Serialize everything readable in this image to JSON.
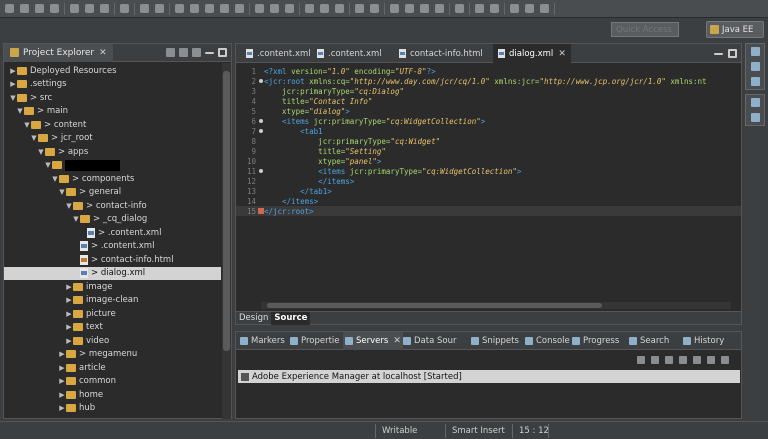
{
  "toolbar": {
    "quick_access_placeholder": "Quick Access",
    "perspective": "Java EE"
  },
  "explorer": {
    "title": "Project Explorer",
    "close": "✕",
    "rows": [
      {
        "label": "Deployed Resources",
        "depth": 0,
        "tw": "▶",
        "icon": "folder"
      },
      {
        "label": ".settings",
        "depth": 0,
        "tw": "▶",
        "icon": "folder"
      },
      {
        "label": "> src",
        "depth": 0,
        "tw": "▼",
        "icon": "folder"
      },
      {
        "label": "> main",
        "depth": 1,
        "tw": "▼",
        "icon": "folder"
      },
      {
        "label": "> content",
        "depth": 2,
        "tw": "▼",
        "icon": "folder"
      },
      {
        "label": "> jcr_root",
        "depth": 3,
        "tw": "▼",
        "icon": "folder"
      },
      {
        "label": "> apps",
        "depth": 4,
        "tw": "▼",
        "icon": "folder"
      },
      {
        "label": "",
        "depth": 5,
        "tw": "▼",
        "icon": "folder",
        "redacted": true
      },
      {
        "label": "> components",
        "depth": 6,
        "tw": "▼",
        "icon": "folder"
      },
      {
        "label": "> general",
        "depth": 7,
        "tw": "▼",
        "icon": "folder"
      },
      {
        "label": "> contact-info",
        "depth": 8,
        "tw": "▼",
        "icon": "folder"
      },
      {
        "label": "> _cq_dialog",
        "depth": 9,
        "tw": "▼",
        "icon": "folder"
      },
      {
        "label": "> .content.xml",
        "depth": 10,
        "tw": "",
        "icon": "xml"
      },
      {
        "label": "> .content.xml",
        "depth": 9,
        "tw": "",
        "icon": "xml"
      },
      {
        "label": "> contact-info.html",
        "depth": 9,
        "tw": "",
        "icon": "html"
      },
      {
        "label": "> dialog.xml",
        "depth": 9,
        "tw": "",
        "icon": "xml",
        "selected": true
      },
      {
        "label": "image",
        "depth": 8,
        "tw": "▶",
        "icon": "folder"
      },
      {
        "label": "image-clean",
        "depth": 8,
        "tw": "▶",
        "icon": "folder"
      },
      {
        "label": "picture",
        "depth": 8,
        "tw": "▶",
        "icon": "folder"
      },
      {
        "label": "text",
        "depth": 8,
        "tw": "▶",
        "icon": "folder"
      },
      {
        "label": "video",
        "depth": 8,
        "tw": "▶",
        "icon": "folder"
      },
      {
        "label": "> megamenu",
        "depth": 7,
        "tw": "▶",
        "icon": "folder"
      },
      {
        "label": "article",
        "depth": 7,
        "tw": "▶",
        "icon": "folder"
      },
      {
        "label": "common",
        "depth": 7,
        "tw": "▶",
        "icon": "folder"
      },
      {
        "label": "home",
        "depth": 7,
        "tw": "▶",
        "icon": "folder"
      },
      {
        "label": "hub",
        "depth": 7,
        "tw": "▶",
        "icon": "folder"
      }
    ]
  },
  "editor": {
    "tabs": [
      {
        "label": ".content.xml",
        "active": false
      },
      {
        "label": ".content.xml",
        "active": false
      },
      {
        "label": "contact-info.html",
        "active": false
      },
      {
        "label": "dialog.xml",
        "active": true
      }
    ],
    "lines": [
      [
        {
          "t": "<?xml ",
          "c": "pi"
        },
        {
          "t": "version=",
          "c": "attr"
        },
        {
          "t": "\"1.0\"",
          "c": "val"
        },
        {
          "t": " encoding=",
          "c": "attr"
        },
        {
          "t": "\"UTF-8\"",
          "c": "val"
        },
        {
          "t": "?>",
          "c": "pi"
        }
      ],
      [
        {
          "t": "<jcr:root ",
          "c": "tag"
        },
        {
          "t": "xmlns:cq=",
          "c": "attr"
        },
        {
          "t": "\"http://www.day.com/jcr/cq/1.0\"",
          "c": "val"
        },
        {
          "t": " xmlns:jcr=",
          "c": "attr"
        },
        {
          "t": "\"http://www.jcp.org/jcr/1.0\"",
          "c": "val"
        },
        {
          "t": " xmlns:nt",
          "c": "attr"
        }
      ],
      [
        {
          "t": "    jcr:primaryType=",
          "c": "attr"
        },
        {
          "t": "\"cq:Dialog\"",
          "c": "val"
        }
      ],
      [
        {
          "t": "    title=",
          "c": "attr"
        },
        {
          "t": "\"Contact Info\"",
          "c": "val"
        }
      ],
      [
        {
          "t": "    xtype=",
          "c": "attr"
        },
        {
          "t": "\"dialog\"",
          "c": "val"
        },
        {
          "t": ">",
          "c": "tag"
        }
      ],
      [
        {
          "t": "    <items ",
          "c": "tag"
        },
        {
          "t": "jcr:primaryType=",
          "c": "attr"
        },
        {
          "t": "\"cq:WidgetCollection\"",
          "c": "val"
        },
        {
          "t": ">",
          "c": "tag"
        }
      ],
      [
        {
          "t": "        <tab1",
          "c": "tag"
        }
      ],
      [
        {
          "t": "            jcr:primaryType=",
          "c": "attr"
        },
        {
          "t": "\"cq:Widget\"",
          "c": "val"
        }
      ],
      [
        {
          "t": "            title=",
          "c": "attr"
        },
        {
          "t": "\"Setting\"",
          "c": "val"
        }
      ],
      [
        {
          "t": "            xtype=",
          "c": "attr"
        },
        {
          "t": "\"panel\"",
          "c": "val"
        },
        {
          "t": ">",
          "c": "tag"
        }
      ],
      [
        {
          "t": "            <items ",
          "c": "tag"
        },
        {
          "t": "jcr:primaryType=",
          "c": "attr"
        },
        {
          "t": "\"cq:WidgetCollection\"",
          "c": "val"
        },
        {
          "t": ">",
          "c": "tag"
        }
      ],
      [
        {
          "t": "            </items>",
          "c": "tag"
        }
      ],
      [
        {
          "t": "        </tab1>",
          "c": "tag"
        }
      ],
      [
        {
          "t": "    </items>",
          "c": "tag"
        }
      ],
      [
        {
          "t": "</jcr:root>",
          "c": "tag"
        }
      ]
    ],
    "fold_lines": [
      2,
      6,
      7,
      11
    ],
    "error_line": 15,
    "current_line": 15,
    "design_tab": "Design",
    "source_tab": "Source"
  },
  "bottom": {
    "tabs": [
      "Markers",
      "Propertie",
      "Servers",
      "Data Sour",
      "Snippets",
      "Console",
      "Progress",
      "Search",
      "History"
    ],
    "active_tab": "Servers",
    "server": "Adobe Experience Manager at localhost",
    "server_status": "[Started]"
  },
  "status": {
    "writable": "Writable",
    "insert_mode": "Smart Insert",
    "position": "15 : 12"
  }
}
